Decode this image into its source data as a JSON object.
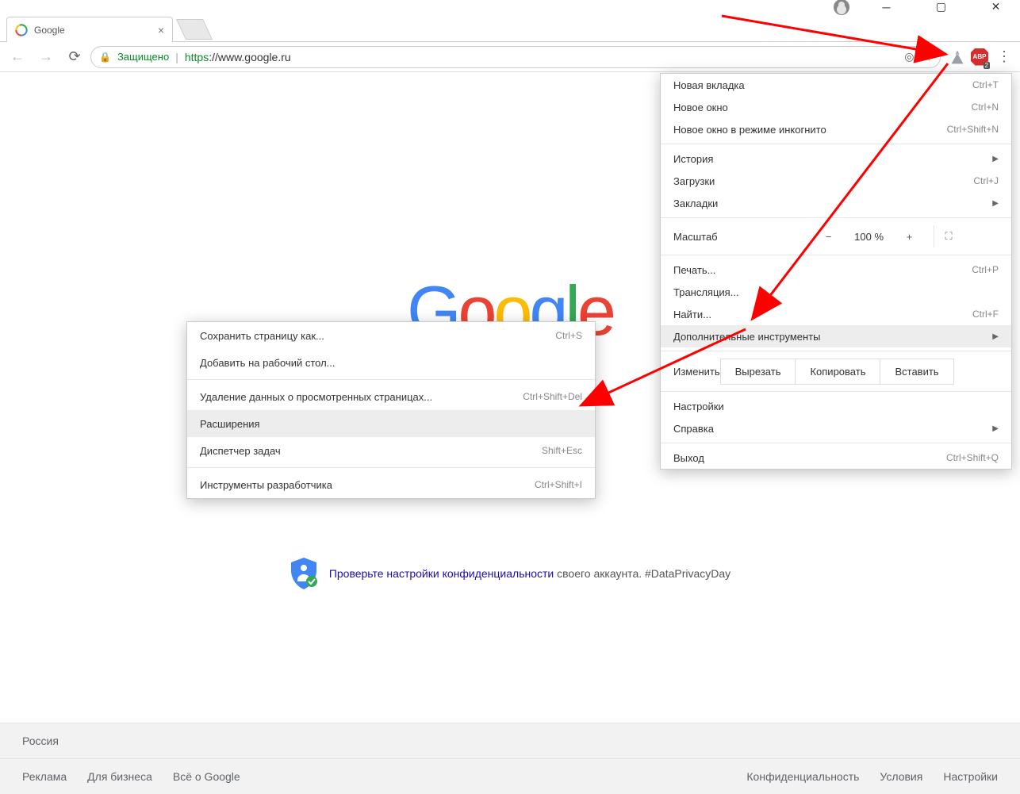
{
  "titlebar": {},
  "tab": {
    "title": "Google"
  },
  "toolbar": {
    "secure_label": "Защищено",
    "url_proto": "https",
    "url_rest": "://www.google.ru",
    "abp_badge": "2"
  },
  "page": {
    "logo": {
      "g1": "G",
      "o1": "o",
      "o2": "o",
      "g2": "g",
      "l": "l",
      "e": "e"
    },
    "privacy_link": "Проверьте настройки конфиденциальности",
    "privacy_tail": " своего аккаунта. #DataPrivacyDay"
  },
  "footer": {
    "country": "Россия",
    "left": {
      "ads": "Реклама",
      "biz": "Для бизнеса",
      "about": "Всё о Google"
    },
    "right": {
      "priv": "Конфиденциальность",
      "terms": "Условия",
      "settings": "Настройки"
    }
  },
  "menu": {
    "new_tab": {
      "label": "Новая вкладка",
      "shortcut": "Ctrl+T"
    },
    "new_window": {
      "label": "Новое окно",
      "shortcut": "Ctrl+N"
    },
    "incognito": {
      "label": "Новое окно в режиме инкогнито",
      "shortcut": "Ctrl+Shift+N"
    },
    "history": {
      "label": "История"
    },
    "downloads": {
      "label": "Загрузки",
      "shortcut": "Ctrl+J"
    },
    "bookmarks": {
      "label": "Закладки"
    },
    "zoom": {
      "label": "Масштаб",
      "value": "100 %",
      "minus": "−",
      "plus": "+"
    },
    "print": {
      "label": "Печать...",
      "shortcut": "Ctrl+P"
    },
    "cast": {
      "label": "Трансляция..."
    },
    "find": {
      "label": "Найти...",
      "shortcut": "Ctrl+F"
    },
    "more_tools": {
      "label": "Дополнительные инструменты"
    },
    "edit": {
      "label": "Изменить",
      "cut": "Вырезать",
      "copy": "Копировать",
      "paste": "Вставить"
    },
    "settings": {
      "label": "Настройки"
    },
    "help": {
      "label": "Справка"
    },
    "exit": {
      "label": "Выход",
      "shortcut": "Ctrl+Shift+Q"
    }
  },
  "submenu": {
    "save_as": {
      "label": "Сохранить страницу как...",
      "shortcut": "Ctrl+S"
    },
    "add_desktop": {
      "label": "Добавить на рабочий стол..."
    },
    "clear_data": {
      "label": "Удаление данных о просмотренных страницах...",
      "shortcut": "Ctrl+Shift+Del"
    },
    "extensions": {
      "label": "Расширения"
    },
    "task_mgr": {
      "label": "Диспетчер задач",
      "shortcut": "Shift+Esc"
    },
    "dev_tools": {
      "label": "Инструменты разработчика",
      "shortcut": "Ctrl+Shift+I"
    }
  }
}
